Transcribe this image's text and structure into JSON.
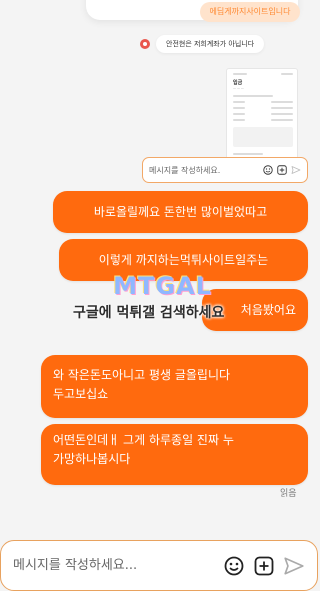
{
  "top": {
    "partial_text": "에딥게까지사이트입니다"
  },
  "system_notice": {
    "text": "안전현은 저희계좌가 아닙니다"
  },
  "mini_input": {
    "placeholder": "메시지를 작성하세요."
  },
  "messages": [
    {
      "lines": [
        "바로올릴께요 돈한번 많이벌었따고"
      ]
    },
    {
      "lines": [
        "이렇게 까지하는먹튀사이트일주는"
      ]
    },
    {
      "lines": [
        "처음봤어요"
      ]
    },
    {
      "lines": [
        "와 작은돈도아니고 평생 글올립니다",
        "두고보십쇼"
      ]
    },
    {
      "lines": [
        "어떤돈인데ㅐ 그게 하루종일 진짜 누",
        "가망하나봅시다"
      ]
    }
  ],
  "read_receipt": "읽음",
  "watermark": {
    "logo": "MTGAL",
    "caption": "구글에 먹튀갤 검색하세요"
  },
  "input": {
    "placeholder": "메시지를 작성하세요..."
  },
  "colors": {
    "accent": "#ff6a0e",
    "border": "#e8a25f",
    "background": "#f4f4f4"
  },
  "icons": {
    "emoji": "smiley-icon",
    "attach": "plus-square-icon",
    "send": "send-icon"
  }
}
